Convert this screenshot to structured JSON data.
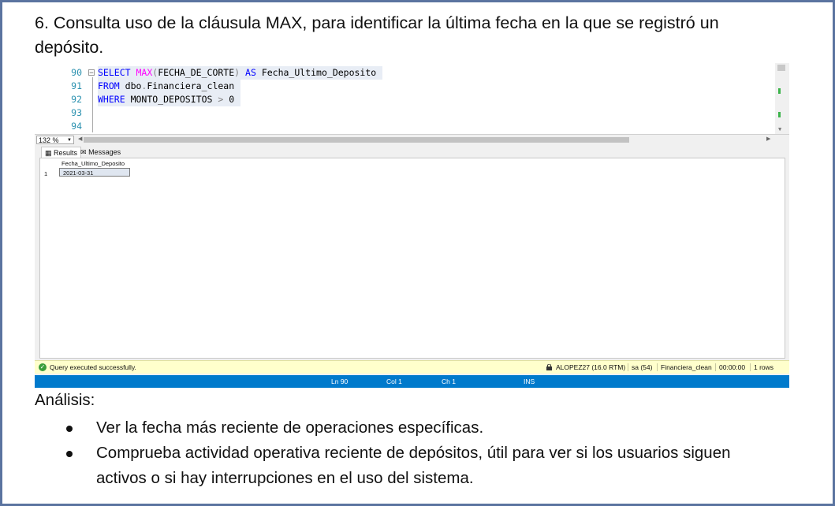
{
  "heading": "6. Consulta uso de la cláusula MAX, para identificar la última fecha en la que se registró un depósito.",
  "editor": {
    "line_numbers": [
      "90",
      "91",
      "92",
      "93",
      "94"
    ],
    "lines": [
      {
        "kw1": "SELECT",
        "fn": "MAX",
        "p1": "(",
        "col": "FECHA_DE_CORTE",
        "p2": ")",
        "kw2": "AS",
        "alias": "Fecha_Ultimo_Deposito"
      },
      {
        "kw1": "FROM",
        "obj": "dbo",
        "dot": ".",
        "tbl": "Financiera_clean"
      },
      {
        "kw1": "WHERE",
        "col": "MONTO_DEPOSITOS",
        "op": ">",
        "val": "0"
      }
    ],
    "zoom": "132 %"
  },
  "tabs": {
    "results": "Results",
    "messages": "Messages"
  },
  "grid": {
    "columns": [
      "Fecha_Ultimo_Deposito"
    ],
    "rows": [
      {
        "num": "1",
        "values": [
          "2021-03-31"
        ]
      }
    ]
  },
  "status": {
    "message": "Query executed successfully.",
    "server": "ALOPEZ27 (16.0 RTM)",
    "user": "sa (54)",
    "database": "Financiera_clean",
    "time": "00:00:00",
    "rows": "1 rows"
  },
  "bottom": {
    "ln": "Ln 90",
    "col": "Col 1",
    "ch": "Ch 1",
    "ins": "INS"
  },
  "analysis": {
    "title": "Análisis:",
    "bullets": [
      "Ver la fecha más reciente de operaciones específicas.",
      "Comprueba actividad operativa reciente de depósitos, útil para ver si los usuarios siguen activos o si hay interrupciones en el uso del sistema."
    ]
  },
  "colors": {
    "accent": "#007acc",
    "status_bg": "#ffffcc",
    "frame": "#5b74a0"
  }
}
